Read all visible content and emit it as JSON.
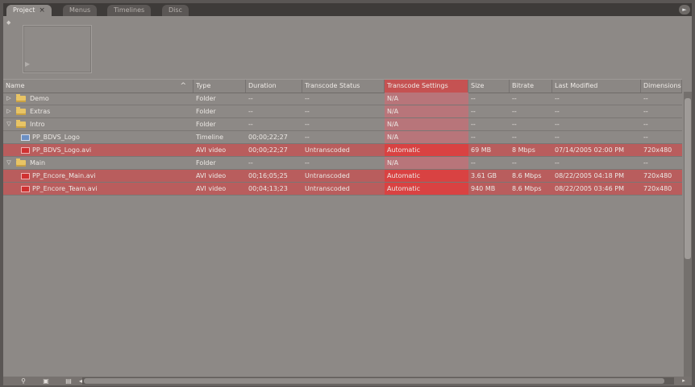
{
  "tabs": [
    {
      "label": "Project",
      "active": true,
      "close": "×"
    },
    {
      "label": "Menus",
      "active": false
    },
    {
      "label": "Timelines",
      "active": false
    },
    {
      "label": "Disc",
      "active": false
    }
  ],
  "panel_menu_icon": "panel-menu-icon",
  "columns": [
    "Name",
    "Type",
    "Duration",
    "Transcode Status",
    "Transcode Settings",
    "Size",
    "Bitrate",
    "Last Modified",
    "Dimensions"
  ],
  "sort_indicator": "^",
  "rows": [
    {
      "name": "Demo",
      "kind": "folder",
      "expand": "▷",
      "type": "Folder",
      "duration": "--",
      "status": "--",
      "settings": "N/A",
      "size": "--",
      "bitrate": "--",
      "modified": "--",
      "dimensions": "--"
    },
    {
      "name": "Extras",
      "kind": "folder",
      "expand": "▷",
      "type": "Folder",
      "duration": "--",
      "status": "--",
      "settings": "N/A",
      "size": "--",
      "bitrate": "--",
      "modified": "--",
      "dimensions": "--"
    },
    {
      "name": "Intro",
      "kind": "folder",
      "expand": "▽",
      "type": "Folder",
      "duration": "--",
      "status": "--",
      "settings": "N/A",
      "size": "--",
      "bitrate": "--",
      "modified": "--",
      "dimensions": "--"
    },
    {
      "name": "PP_BDVS_Logo",
      "kind": "timeline",
      "type": "Timeline",
      "duration": "00;00;22;27",
      "status": "--",
      "settings": "N/A",
      "size": "--",
      "bitrate": "--",
      "modified": "--",
      "dimensions": "--"
    },
    {
      "name": "PP_BDVS_Logo.avi",
      "kind": "video",
      "type": "AVI video",
      "duration": "00;00;22;27",
      "status": "Untranscoded",
      "settings": "Automatic",
      "size": "69 MB",
      "bitrate": "8 Mbps",
      "modified": "07/14/2005 02:00 PM",
      "dimensions": "720x480"
    },
    {
      "name": "Main",
      "kind": "folder",
      "expand": "▽",
      "type": "Folder",
      "duration": "--",
      "status": "--",
      "settings": "N/A",
      "size": "--",
      "bitrate": "--",
      "modified": "--",
      "dimensions": "--"
    },
    {
      "name": "PP_Encore_Main.avi",
      "kind": "video",
      "type": "AVI video",
      "duration": "00;16;05;25",
      "status": "Untranscoded",
      "settings": "Automatic",
      "size": "3.61 GB",
      "bitrate": "8.6 Mbps",
      "modified": "08/22/2005 04:18 PM",
      "dimensions": "720x480"
    },
    {
      "name": "PP_Encore_Team.avi",
      "kind": "video",
      "type": "AVI video",
      "duration": "00;04;13;23",
      "status": "Untranscoded",
      "settings": "Automatic",
      "size": "940 MB",
      "bitrate": "8.6 Mbps",
      "modified": "08/22/2005 03:46 PM",
      "dimensions": "720x480"
    }
  ],
  "colors": {
    "panel": "#8d8986",
    "highlight_row": "#b95d5d",
    "settings_column": "#d94242"
  }
}
